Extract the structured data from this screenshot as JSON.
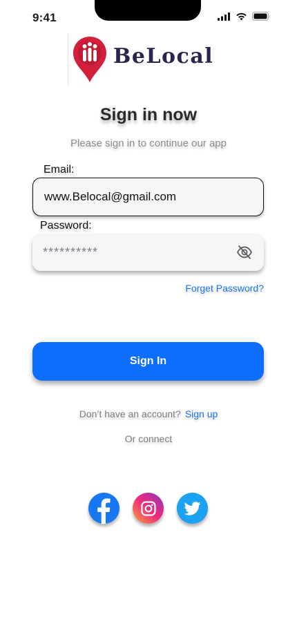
{
  "status_bar": {
    "time": "9:41"
  },
  "brand": {
    "name": "BeLocal",
    "primary_color": "#d21f3c",
    "text_color": "#2d2350"
  },
  "header": {
    "title": "Sign in now",
    "subtitle": "Please sign in to continue our app"
  },
  "form": {
    "email_label": "Email:",
    "email_value": "www.Belocal@gmail.com",
    "password_label": "Password:",
    "password_value": "**********",
    "forgot_link": "Forget Password?",
    "submit_label": "Sign In"
  },
  "footer": {
    "account_question": "Don’t have an account?",
    "signup_link": "Sign up",
    "or_connect": "Or connect"
  },
  "social": [
    {
      "name": "facebook",
      "icon": "facebook-icon",
      "color": "#1877f2"
    },
    {
      "name": "instagram",
      "icon": "instagram-icon",
      "color": "#ee2a7b"
    },
    {
      "name": "twitter",
      "icon": "twitter-icon",
      "color": "#1da1f2"
    }
  ],
  "colors": {
    "accent": "#0d6efd",
    "link": "#1a73f5",
    "field_bg": "#f6f6f8"
  }
}
